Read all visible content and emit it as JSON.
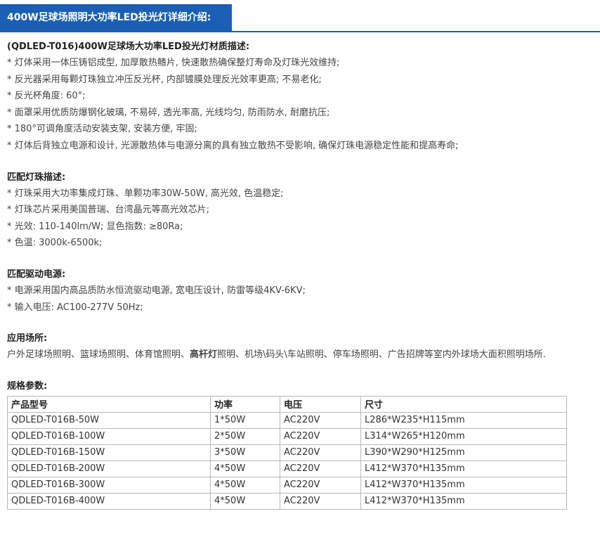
{
  "header": {
    "title": "400W足球场照明大功率LED投光灯详细介绍:"
  },
  "materials": {
    "title": "(QDLED-T016)400W足球场大功率LED投光灯材质描述:",
    "items": [
      "* 灯体采用一体压铸铝成型, 加厚散热鳍片, 快速散热确保整灯寿命及灯珠光效维持;",
      "* 反光器采用每颗灯珠独立冲压反光杯, 内部镀膜处理反光效率更高; 不易老化;",
      "* 反光杯角度: 60°;",
      "* 面罩采用优质防爆钢化玻璃, 不易碎, 透光率高, 光线均匀, 防雨防水, 耐磨抗压;",
      "* 180°可调角度活动安装支架, 安装方便, 牢固;",
      "* 灯体后背独立电源和设计, 光源散热体与电源分离的具有独立散热不受影响, 确保灯珠电源稳定性能和提高寿命;"
    ]
  },
  "leds": {
    "title": "匹配灯珠描述:",
    "items": [
      "* 灯珠采用大功率集成灯珠、单颗功率30W-50W, 高光效, 色温稳定;",
      "* 灯珠芯片采用美国普瑞、台湾晶元等高光效芯片;",
      "* 光效: 110-140lm/W; 显色指数: ≥80Ra;",
      "* 色温: 3000k-6500k;"
    ]
  },
  "driver": {
    "title": "匹配驱动电源:",
    "items": [
      "* 电源采用国内高品质防水恒流驱动电源, 宽电压设计, 防雷等级4KV-6KV;",
      "* 输入电压: AC100-277V 50Hz;"
    ]
  },
  "applications": {
    "title": "应用场所:",
    "text_before": "户外足球场照明、篮球场照明、体育馆照明、",
    "text_bold": "高杆灯",
    "text_after": "照明、机场\\码头\\车站照明、停车场照明、广告招牌等室内外球场大面积照明场所."
  },
  "specs": {
    "title": "规格参数:",
    "headers": [
      "产品型号",
      "功率",
      "电压",
      "尺寸"
    ],
    "rows": [
      [
        "QDLED-T016B-50W",
        "1*50W",
        "AC220V",
        "L286*W235*H115mm"
      ],
      [
        "QDLED-T016B-100W",
        "2*50W",
        "AC220V",
        "L314*W265*H120mm"
      ],
      [
        "QDLED-T016B-150W",
        "3*50W",
        "AC220V",
        "L390*W290*H125mm"
      ],
      [
        "QDLED-T016B-200W",
        "4*50W",
        "AC220V",
        "L412*W370*H135mm"
      ],
      [
        "QDLED-T016B-300W",
        "4*50W",
        "AC220V",
        "L412*W370*H135mm"
      ],
      [
        "QDLED-T016B-400W",
        "4*50W",
        "AC220V",
        "L412*W370*H135mm"
      ]
    ]
  },
  "colors": {
    "accent": "#1a5fb4"
  }
}
